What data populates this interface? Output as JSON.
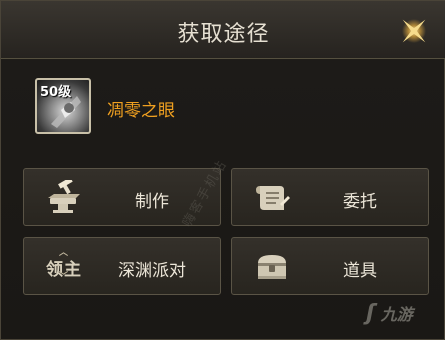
{
  "dialog": {
    "title": "获取途径"
  },
  "item": {
    "level": "50级",
    "name": "凋零之眼"
  },
  "buttons": [
    {
      "label": "制作",
      "icon": "anvil-hammer-icon"
    },
    {
      "label": "委托",
      "icon": "scroll-quill-icon"
    },
    {
      "label": "深渊派对",
      "icon": "boss-icon",
      "icon_text": "领主"
    },
    {
      "label": "道具",
      "icon": "treasure-chest-icon"
    }
  ],
  "watermark": {
    "site": "嗨客手机站",
    "brand": "九游"
  },
  "colors": {
    "item_name": "#f0a020",
    "title": "#e6e0d2",
    "button_text": "#ece6d8"
  }
}
